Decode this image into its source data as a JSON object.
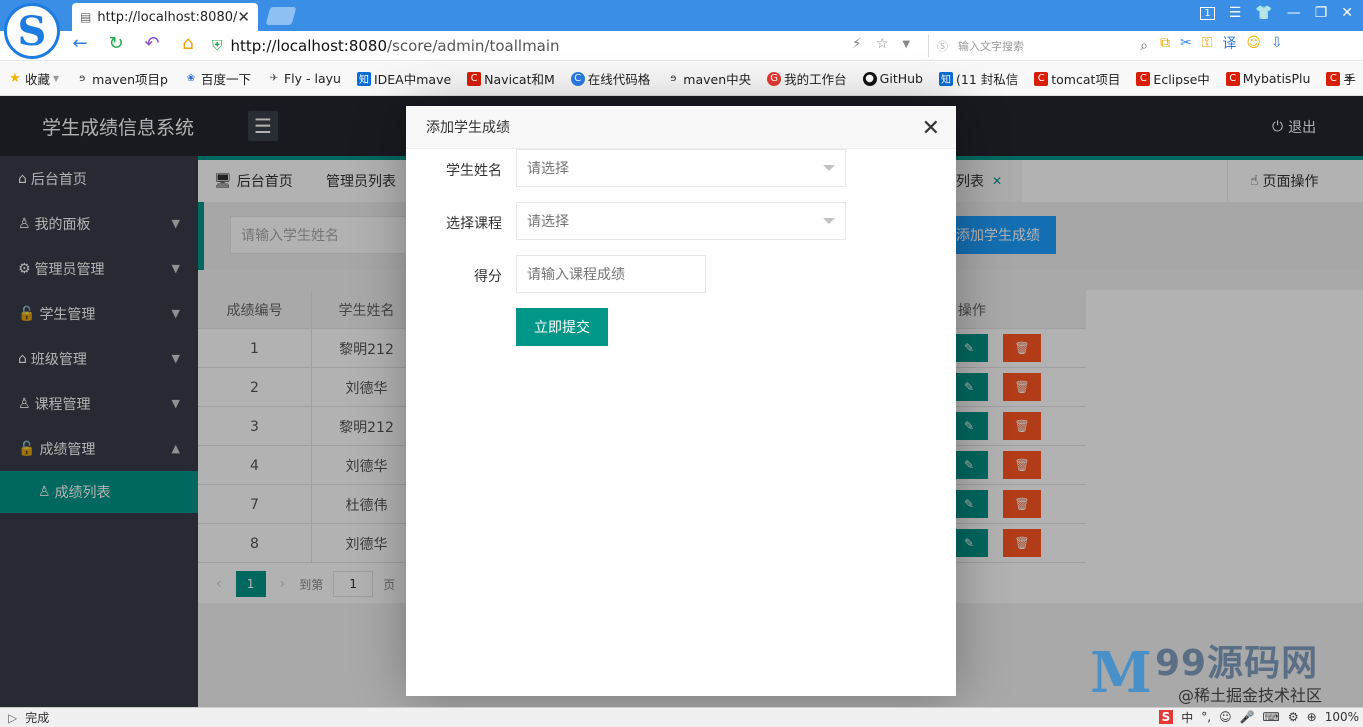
{
  "browser": {
    "tab_title": "http://localhost:8080/s",
    "url_host": "http://localhost:8080",
    "url_path": "/score/admin/toallmain",
    "search_placeholder": "输入文字搜索",
    "window_badge": "1",
    "bookmarks": [
      {
        "label": "收藏",
        "icon": "star-icon",
        "color": "#f0b400"
      },
      {
        "label": "maven项目p",
        "icon": "maven-icon",
        "color": "#333333"
      },
      {
        "label": "百度一下",
        "icon": "baidu-icon",
        "color": "#2f6de1"
      },
      {
        "label": "Fly - layu",
        "icon": "fly-icon",
        "color": "#555555"
      },
      {
        "label": "IDEA中mave",
        "icon": "zhihu-icon",
        "color": "#0a6cd6"
      },
      {
        "label": "Navicat和M",
        "icon": "csdn-icon",
        "color": "#d81e06"
      },
      {
        "label": "在线代码格",
        "icon": "c-icon",
        "color": "#2b7de9"
      },
      {
        "label": "maven中央",
        "icon": "maven-icon",
        "color": "#333333"
      },
      {
        "label": "我的工作台",
        "icon": "g-icon",
        "color": "#e53935"
      },
      {
        "label": "GitHub",
        "icon": "github-icon",
        "color": "#111111"
      },
      {
        "label": "(11 封私信",
        "icon": "zhihu-icon",
        "color": "#0a6cd6"
      },
      {
        "label": "tomcat项目",
        "icon": "csdn-icon",
        "color": "#d81e06"
      },
      {
        "label": "Eclipse中",
        "icon": "csdn-icon",
        "color": "#d81e06"
      },
      {
        "label": "MybatisPlu",
        "icon": "csdn-icon",
        "color": "#d81e06"
      },
      {
        "label": "手",
        "icon": "csdn-icon",
        "color": "#d81e06"
      }
    ],
    "status_text": "完成",
    "zoom": "100%"
  },
  "app": {
    "brand": "学生成绩信息系统",
    "logout": "退出",
    "sidebar": [
      {
        "label": "后台首页",
        "icon": "home-icon",
        "caret": ""
      },
      {
        "label": "我的面板",
        "icon": "user-icon",
        "caret": "down"
      },
      {
        "label": "管理员管理",
        "icon": "gear-icon",
        "caret": "down"
      },
      {
        "label": "学生管理",
        "icon": "lock-icon",
        "caret": "down"
      },
      {
        "label": "班级管理",
        "icon": "home-icon",
        "caret": "down"
      },
      {
        "label": "课程管理",
        "icon": "user-icon",
        "caret": "down"
      },
      {
        "label": "成绩管理",
        "icon": "lock-icon",
        "caret": "up"
      }
    ],
    "sidebar_sub": "成绩列表",
    "tabs": {
      "home": "后台首页",
      "admins": "管理员列表",
      "scores": "列表",
      "page_ops": "页面操作"
    },
    "search_placeholder": "请输入学生姓名",
    "add_button": "添加学生成绩",
    "table": {
      "headers": [
        "成绩编号",
        "学生姓名",
        "操作"
      ],
      "rows": [
        {
          "id": "1",
          "name": "黎明212"
        },
        {
          "id": "2",
          "name": "刘德华"
        },
        {
          "id": "3",
          "name": "黎明212"
        },
        {
          "id": "4",
          "name": "刘德华"
        },
        {
          "id": "7",
          "name": "杜德伟"
        },
        {
          "id": "8",
          "name": "刘德华"
        }
      ]
    },
    "pager": {
      "current": "1",
      "goto_label": "到第",
      "goto_value": "1",
      "page_label": "页"
    }
  },
  "modal": {
    "title": "添加学生成绩",
    "fields": {
      "student_label": "学生姓名",
      "student_value": "请选择",
      "course_label": "选择课程",
      "course_value": "请选择",
      "score_label": "得分",
      "score_placeholder": "请输入课程成绩"
    },
    "submit": "立即提交"
  },
  "watermark": {
    "brand": "99源码网",
    "sub": "@稀土掘金技术社区"
  },
  "colors": {
    "accent": "#009688",
    "blue": "#1e9fff",
    "danger": "#ff5722",
    "dark": "#23262e",
    "sidebar": "#393d49"
  }
}
